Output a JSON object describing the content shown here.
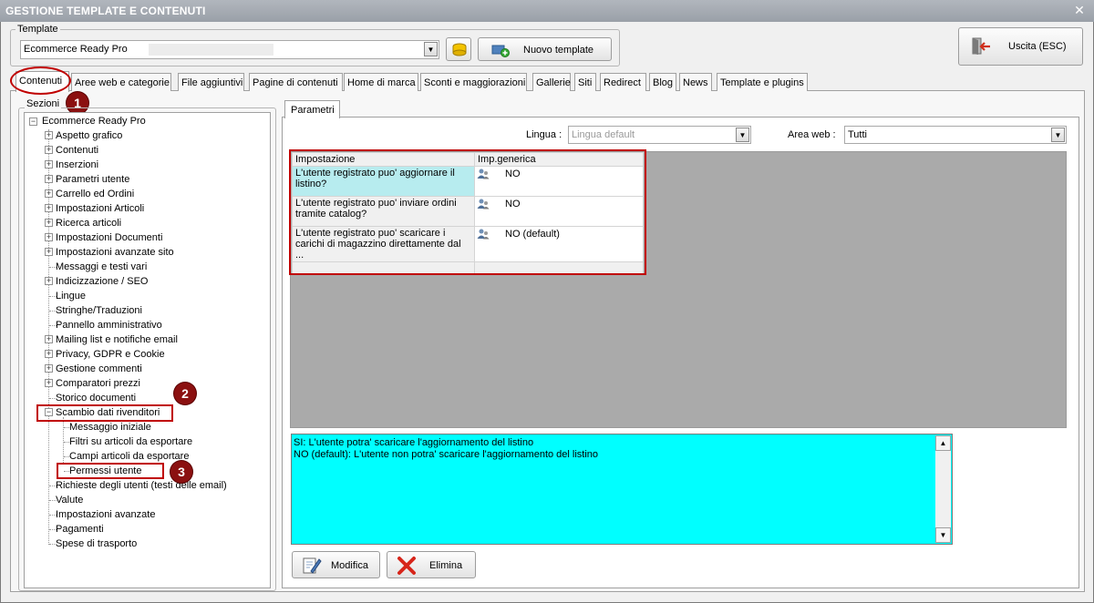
{
  "window": {
    "title": "GESTIONE TEMPLATE E CONTENUTI",
    "close_glyph": "✕"
  },
  "template_group": {
    "label": "Template",
    "selected": "Ecommerce Ready Pro",
    "new_template_label": "Nuovo template"
  },
  "exit_button": {
    "label": "Uscita (ESC)"
  },
  "tabs": [
    {
      "label": "Contenuti"
    },
    {
      "label": "Aree web e categorie"
    },
    {
      "label": "File aggiuntivi"
    },
    {
      "label": "Pagine di contenuti"
    },
    {
      "label": "Home di marca"
    },
    {
      "label": "Sconti e maggiorazioni"
    },
    {
      "label": "Gallerie"
    },
    {
      "label": "Siti"
    },
    {
      "label": "Redirect"
    },
    {
      "label": "Blog"
    },
    {
      "label": "News"
    },
    {
      "label": "Template e plugins"
    }
  ],
  "sections": {
    "label": "Sezioni",
    "root": "Ecommerce Ready Pro",
    "items": [
      {
        "label": "Aspetto grafico",
        "expandable": true
      },
      {
        "label": "Contenuti",
        "expandable": true
      },
      {
        "label": "Inserzioni",
        "expandable": true
      },
      {
        "label": "Parametri utente",
        "expandable": true
      },
      {
        "label": "Carrello ed Ordini",
        "expandable": true
      },
      {
        "label": "Impostazioni Articoli",
        "expandable": true
      },
      {
        "label": "Ricerca articoli",
        "expandable": true
      },
      {
        "label": "Impostazioni Documenti",
        "expandable": true
      },
      {
        "label": "Impostazioni avanzate sito",
        "expandable": true
      },
      {
        "label": "Messaggi e testi vari",
        "expandable": false
      },
      {
        "label": "Indicizzazione / SEO",
        "expandable": true
      },
      {
        "label": "Lingue",
        "expandable": false
      },
      {
        "label": "Stringhe/Traduzioni",
        "expandable": false
      },
      {
        "label": "Pannello amministrativo",
        "expandable": false
      },
      {
        "label": "Mailing list e notifiche email",
        "expandable": true
      },
      {
        "label": "Privacy, GDPR e Cookie",
        "expandable": true
      },
      {
        "label": "Gestione commenti",
        "expandable": true
      },
      {
        "label": "Comparatori prezzi",
        "expandable": true
      },
      {
        "label": "Storico documenti",
        "expandable": false
      },
      {
        "label": "Scambio dati rivenditori",
        "expandable": true,
        "expanded": true
      },
      {
        "label": "Messaggio iniziale",
        "child": true
      },
      {
        "label": "Filtri su articoli da esportare",
        "child": true
      },
      {
        "label": "Campi articoli da esportare",
        "child": true
      },
      {
        "label": "Permessi utente",
        "child": true
      },
      {
        "label": "Richieste degli utenti (testi delle email)",
        "expandable": false
      },
      {
        "label": "Valute",
        "expandable": false
      },
      {
        "label": "Impostazioni avanzate",
        "expandable": false
      },
      {
        "label": "Pagamenti",
        "expandable": false
      },
      {
        "label": "Spese di trasporto",
        "expandable": false
      }
    ]
  },
  "badges": [
    "1",
    "2",
    "3"
  ],
  "parametri": {
    "tab_label": "Parametri",
    "lingua_label": "Lingua :",
    "lingua_value": "Lingua default",
    "area_label": "Area web :",
    "area_value": "Tutti",
    "columns": [
      "Impostazione",
      "Imp.generica"
    ],
    "rows": [
      {
        "line1": "L'utente registrato puo' aggiornare il",
        "line2": "listino?",
        "value": "NO"
      },
      {
        "line1": "L'utente registrato puo' inviare ordini",
        "line2": "tramite catalog?",
        "value": "NO"
      },
      {
        "line1": "L'utente registrato puo' scaricare i",
        "line2": "carichi di magazzino direttamente dal ...",
        "value": "NO (default)"
      }
    ],
    "description": [
      "SI: L'utente potra' scaricare l'aggiornamento del listino",
      "NO (default): L'utente non potra' scaricare l'aggiornamento del listino"
    ],
    "edit_label": "Modifica",
    "delete_label": "Elimina"
  },
  "colors": {
    "highlight_red": "#c00000",
    "badge": "#8b1010",
    "description_bg": "#00ffff",
    "selected_cell": "#b7ecef"
  }
}
